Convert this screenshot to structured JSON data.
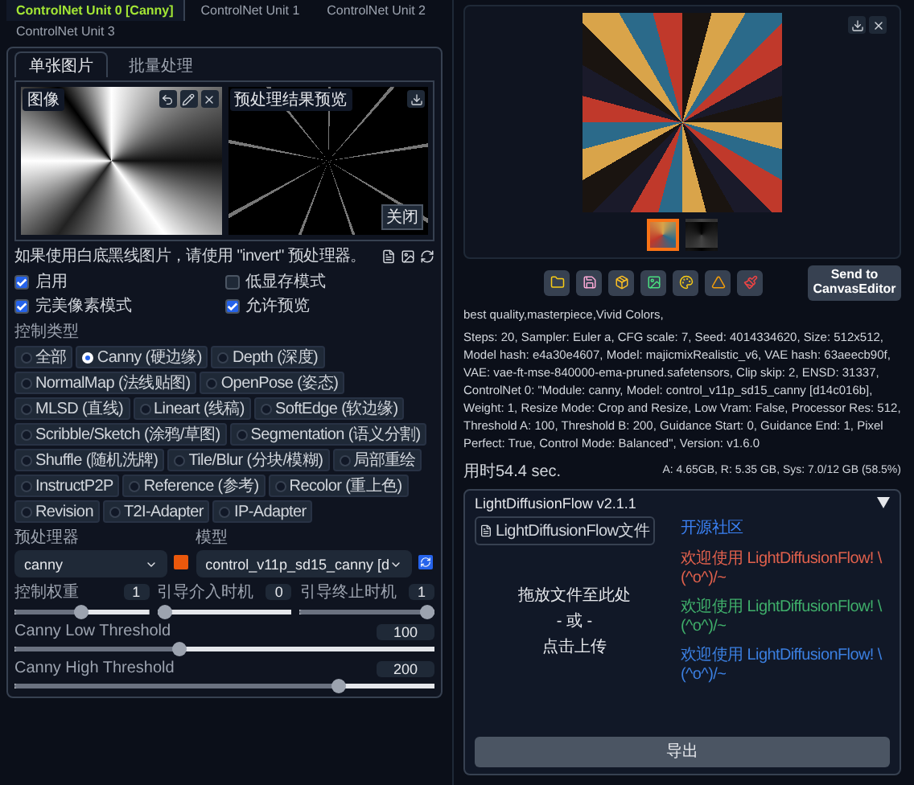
{
  "unit_tabs": [
    {
      "label": "ControlNet Unit 0 [Canny]",
      "selected": true
    },
    {
      "label": "ControlNet Unit 1",
      "selected": false
    },
    {
      "label": "ControlNet Unit 2",
      "selected": false
    },
    {
      "label": "ControlNet Unit 3",
      "selected": false
    }
  ],
  "input_tabs": [
    {
      "label": "单张图片",
      "selected": true
    },
    {
      "label": "批量处理",
      "selected": false
    }
  ],
  "image_panel": {
    "label": "图像"
  },
  "preview_panel": {
    "label": "预处理结果预览",
    "close": "关闭"
  },
  "hint": "如果使用白底黑线图片，请使用 \"invert\" 预处理器。",
  "options": [
    {
      "label": "启用",
      "checked": true
    },
    {
      "label": "低显存模式",
      "checked": false
    },
    {
      "label": "完美像素模式",
      "checked": true
    },
    {
      "label": "允许预览",
      "checked": true
    }
  ],
  "control_type": {
    "label": "控制类型",
    "options": [
      {
        "label": "全部",
        "selected": false
      },
      {
        "label": "Canny (硬边缘)",
        "selected": true
      },
      {
        "label": "Depth (深度)",
        "selected": false
      },
      {
        "label": "NormalMap (法线贴图)",
        "selected": false
      },
      {
        "label": "OpenPose (姿态)",
        "selected": false
      },
      {
        "label": "MLSD (直线)",
        "selected": false
      },
      {
        "label": "Lineart (线稿)",
        "selected": false
      },
      {
        "label": "SoftEdge (软边缘)",
        "selected": false
      },
      {
        "label": "Scribble/Sketch (涂鸦/草图)",
        "selected": false
      },
      {
        "label": "Segmentation (语义分割)",
        "selected": false
      },
      {
        "label": "Shuffle (随机洗牌)",
        "selected": false
      },
      {
        "label": "Tile/Blur (分块/模糊)",
        "selected": false
      },
      {
        "label": "局部重绘",
        "selected": false
      },
      {
        "label": "InstructP2P",
        "selected": false
      },
      {
        "label": "Reference (参考)",
        "selected": false
      },
      {
        "label": "Recolor (重上色)",
        "selected": false
      },
      {
        "label": "Revision",
        "selected": false
      },
      {
        "label": "T2I-Adapter",
        "selected": false
      },
      {
        "label": "IP-Adapter",
        "selected": false
      }
    ]
  },
  "preprocessor": {
    "label": "预处理器",
    "value": "canny"
  },
  "model": {
    "label": "模型",
    "value": "control_v11p_sd15_canny [d"
  },
  "sliders": [
    {
      "label": "控制权重",
      "value": "1",
      "level": 0.5
    },
    {
      "label": "引导介入时机",
      "value": "0",
      "level": 0
    },
    {
      "label": "引导终止时机",
      "value": "1",
      "level": 1
    }
  ],
  "threshold_sliders": [
    {
      "label": "Canny Low Threshold",
      "value": "100",
      "level": 0.39
    },
    {
      "label": "Canny High Threshold",
      "value": "200",
      "level": 0.78
    }
  ],
  "output": {
    "thumbnails": [
      {
        "selected": true
      },
      {
        "selected": false
      }
    ],
    "send_to": "Send to CanvasEditor",
    "prompt": "best quality,masterpiece,Vivid Colors,",
    "parameters": "Steps: 20, Sampler: Euler a, CFG scale: 7, Seed: 4014334620, Size: 512x512, Model hash: e4a30e4607, Model: majicmixRealistic_v6, VAE hash: 63aeecb90f, VAE: vae-ft-mse-840000-ema-pruned.safetensors, Clip skip: 2, ENSD: 31337, ControlNet 0: \"Module: canny, Model: control_v11p_sd15_canny [d14c016b], Weight: 1, Resize Mode: Crop and Resize, Low Vram: False, Processor Res: 512, Threshold A: 100, Threshold B: 200, Guidance Start: 0, Guidance End: 1, Pixel Perfect: True, Control Mode: Balanced\", Version: v1.6.0",
    "time": "用时54.4 sec.",
    "memory": "A: 4.65GB, R: 5.35 GB, Sys: 7.0/12 GB (58.5%)"
  },
  "flow": {
    "title": "LightDiffusionFlow v2.1.1",
    "expanded": true,
    "file_label": "LightDiffusionFlow文件",
    "drop_text": "拖放文件至此处",
    "or_text": "- 或 -",
    "upload_text": "点击上传",
    "link": "开源社区",
    "messages": [
      {
        "text": "欢迎使用 LightDiffusionFlow! \\(^o^)/~",
        "color": "#e0604c"
      },
      {
        "text": "欢迎使用 LightDiffusionFlow! \\(^o^)/~",
        "color": "#3fae6a"
      },
      {
        "text": "欢迎使用 LightDiffusionFlow! \\(^o^)/~",
        "color": "#3b7fe0"
      }
    ],
    "export": "导出"
  }
}
